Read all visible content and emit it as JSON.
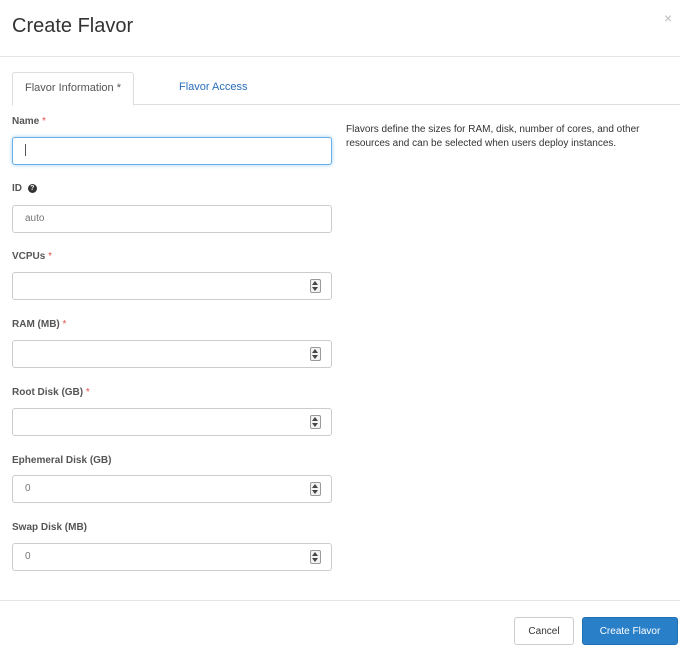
{
  "dialog": {
    "title": "Create Flavor",
    "close_glyph": "×"
  },
  "tabs": [
    {
      "label": "Flavor Information *"
    },
    {
      "label": "Flavor Access"
    }
  ],
  "form": {
    "name": {
      "label": "Name",
      "required_mark": "*",
      "value": ""
    },
    "id": {
      "label": "ID",
      "value": "auto"
    },
    "vcpus": {
      "label": "VCPUs",
      "required_mark": "*",
      "value": ""
    },
    "ram": {
      "label": "RAM (MB)",
      "required_mark": "*",
      "value": ""
    },
    "root_disk": {
      "label": "Root Disk (GB)",
      "required_mark": "*",
      "value": ""
    },
    "ephemeral_disk": {
      "label": "Ephemeral Disk (GB)",
      "value": "0"
    },
    "swap_disk": {
      "label": "Swap Disk (MB)",
      "value": "0"
    }
  },
  "help_text": "Flavors define the sizes for RAM, disk, number of cores, and other resources and can be selected when users deploy instances.",
  "footer": {
    "cancel_label": "Cancel",
    "create_label": "Create Flavor"
  },
  "colors": {
    "primary": "#2a80c8",
    "link": "#2a6ebb",
    "required": "#e0504b",
    "focus": "#66afe9"
  }
}
